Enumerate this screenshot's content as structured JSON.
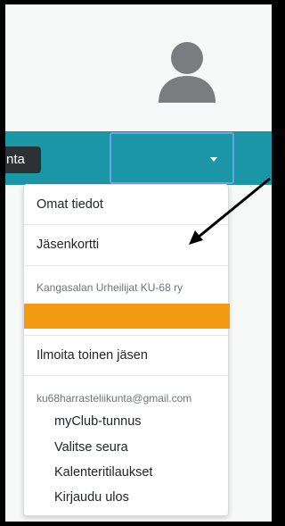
{
  "header": {
    "club_chip_text": "nta",
    "avatar_icon": "user-avatar-icon",
    "menu_caret_icon": "caret-down-icon"
  },
  "colors": {
    "teal_bar": "#1a96a6",
    "dark_chip": "#2b3135",
    "orange_highlight": "#f39c12",
    "focus_outline": "#6aa3e6"
  },
  "menu": {
    "my_info": "Omat tiedot",
    "member_card": "Jäsenkortti",
    "club_name": "Kangasalan Urheilijat KU-68 ry",
    "register_other": "Ilmoita toinen jäsen",
    "account_email": "ku68harrasteliikunta@gmail.com",
    "myclub_id": "myClub-tunnus",
    "choose_club": "Valitse seura",
    "calendar_subscriptions": "Kalenteritilaukset",
    "log_out": "Kirjaudu ulos"
  }
}
